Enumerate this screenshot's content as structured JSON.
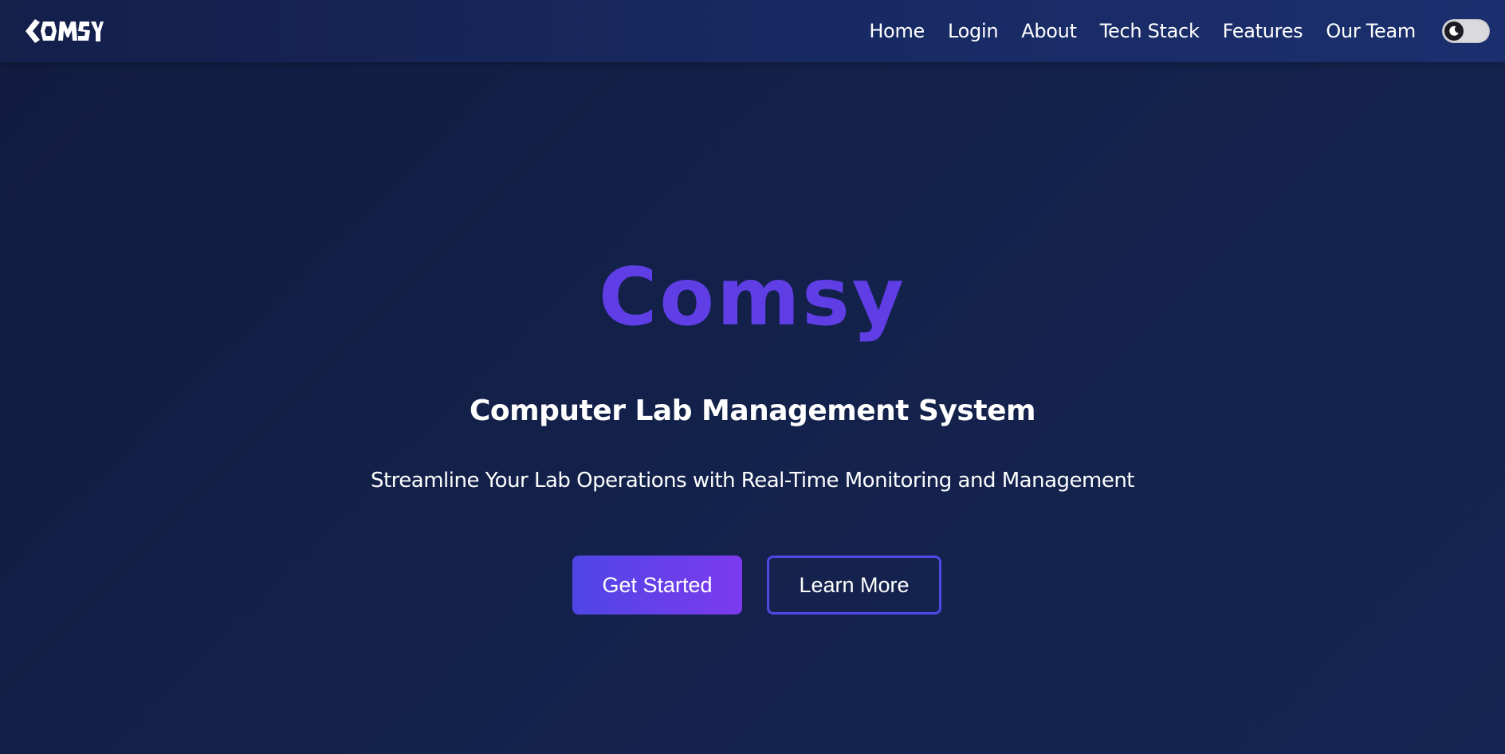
{
  "brand": {
    "logo_text": "COMSY",
    "accent_color": "#5f3ee6"
  },
  "nav": {
    "links": [
      {
        "label": "Home"
      },
      {
        "label": "Login"
      },
      {
        "label": "About"
      },
      {
        "label": "Tech Stack"
      },
      {
        "label": "Features"
      },
      {
        "label": "Our Team"
      }
    ],
    "theme_toggle": {
      "icon": "moon-icon",
      "state": "dark"
    }
  },
  "hero": {
    "title": "Comsy",
    "subtitle": "Computer Lab Management System",
    "tagline": "Streamline Your Lab Operations with Real-Time Monitoring and Management",
    "primary_button": "Get Started",
    "secondary_button": "Learn More"
  },
  "colors": {
    "background": "#13214a",
    "navbar": "#182a63",
    "button_gradient_start": "#4f46e5",
    "button_gradient_end": "#7c3aed",
    "outline_button_border": "#5048e5"
  }
}
